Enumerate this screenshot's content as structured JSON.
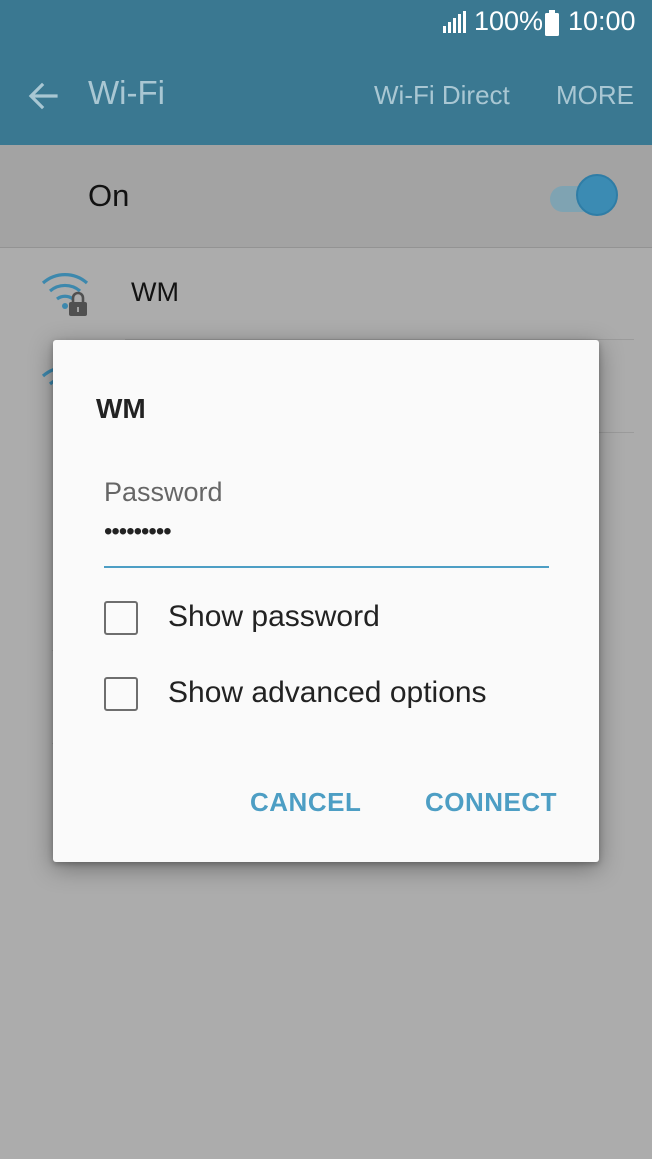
{
  "status_bar": {
    "battery_percent": "100%",
    "time": "10:00",
    "icons": [
      "signal-icon",
      "battery-icon"
    ]
  },
  "app_bar": {
    "title": "Wi-Fi",
    "back_icon": "arrow-left-icon",
    "wifi_direct_label": "Wi-Fi Direct",
    "more_label": "MORE"
  },
  "wifi_toggle": {
    "label": "On",
    "state": "on"
  },
  "networks": [
    {
      "ssid": "WM",
      "icon": "wifi-locked-icon"
    },
    {
      "ssid": "",
      "icon": "wifi-icon"
    }
  ],
  "dialog": {
    "title": "WM",
    "password_label": "Password",
    "password_value": "•••••••••",
    "show_password_label": "Show password",
    "show_password_checked": false,
    "show_advanced_label": "Show advanced options",
    "show_advanced_checked": false,
    "cancel_label": "CANCEL",
    "connect_label": "CONNECT"
  },
  "colors": {
    "header": "#3a7891",
    "accent": "#4d9ec4",
    "scrim": "#acacac",
    "dialog_bg": "#fafafa"
  }
}
